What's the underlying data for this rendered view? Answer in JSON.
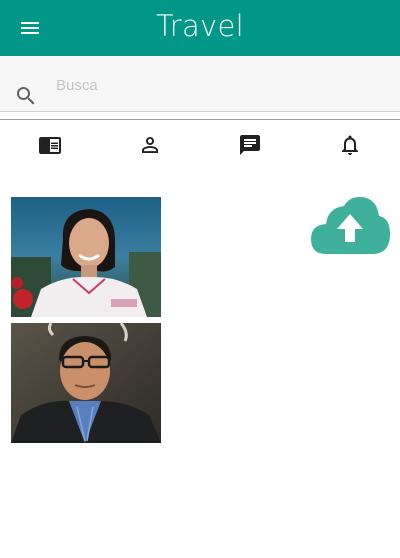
{
  "app": {
    "title": "Travel",
    "accent_color": "#009688",
    "menu_icon": "menu-icon"
  },
  "search": {
    "placeholder": "Busca",
    "value": "",
    "icon": "search-icon"
  },
  "tabs": [
    {
      "name": "chrome-reader-icon"
    },
    {
      "name": "person-icon"
    },
    {
      "name": "chat-icon"
    },
    {
      "name": "bell-icon"
    }
  ],
  "photos": [
    {
      "subject": "woman-portrait"
    },
    {
      "subject": "man-portrait"
    }
  ],
  "upload": {
    "icon": "cloud-upload-icon",
    "color": "#3fb09c"
  }
}
